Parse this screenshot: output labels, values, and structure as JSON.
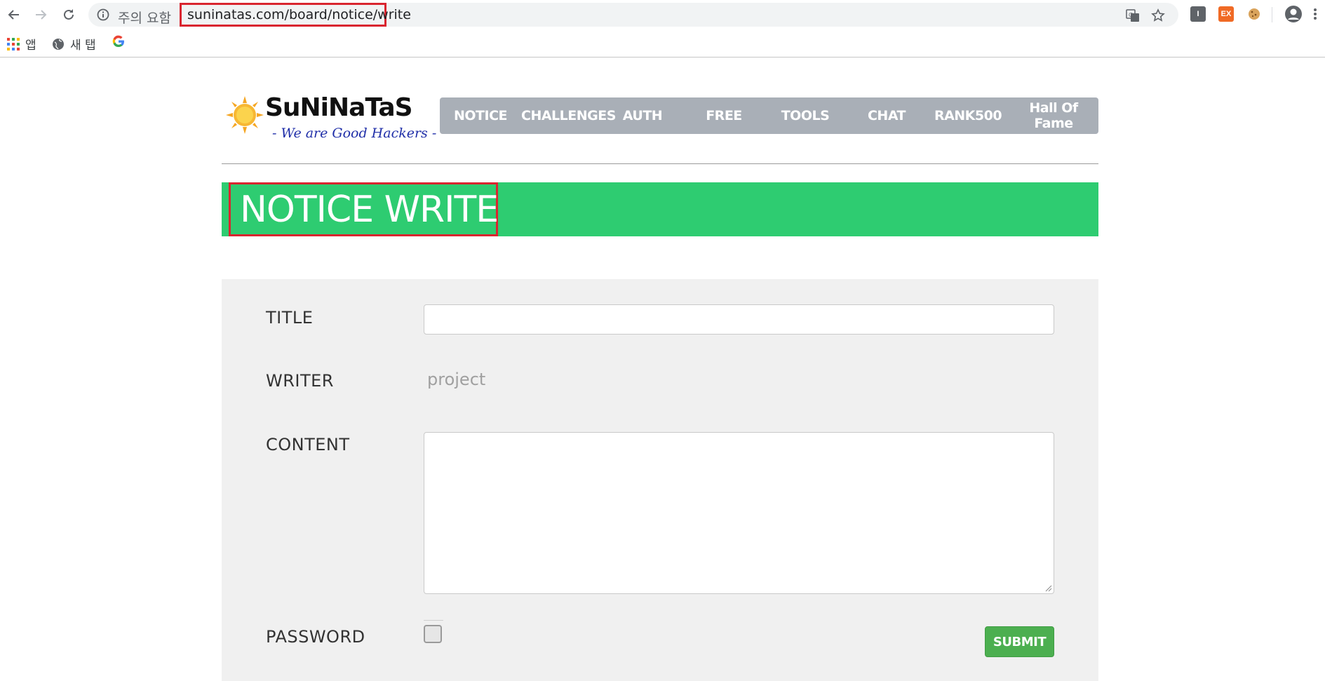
{
  "browser": {
    "security_label": "주의 요함",
    "url": "suninatas.com/board/notice/write",
    "bookmarks": [
      {
        "label": "앱"
      },
      {
        "label": "새 탭"
      },
      {
        "label": ""
      }
    ],
    "extensions": [
      {
        "label": "I"
      },
      {
        "label": "EX"
      }
    ]
  },
  "logo": {
    "title": "SuNiNaTaS",
    "subtitle": "- We are Good Hackers -"
  },
  "nav": {
    "items": [
      "NOTICE",
      "CHALLENGES",
      "AUTH",
      "FREE",
      "TOOLS",
      "CHAT",
      "RANK500",
      "Hall Of Fame"
    ]
  },
  "banner": {
    "title": "NOTICE WRITE"
  },
  "form": {
    "title_label": "TITLE",
    "title_value": "",
    "writer_label": "WRITER",
    "writer_value": "project",
    "content_label": "CONTENT",
    "content_value": "",
    "password_label": "PASSWORD",
    "submit_label": "SUBMIT"
  },
  "colors": {
    "banner": "#2ecc71",
    "nav": "#a9afb7",
    "submit": "#4caf50",
    "highlight": "#d9252f"
  }
}
